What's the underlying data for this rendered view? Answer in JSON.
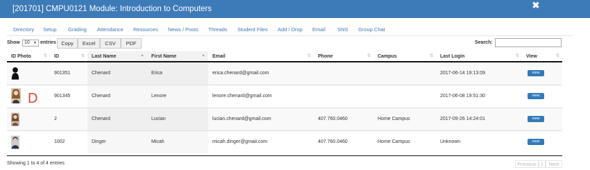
{
  "window": {
    "title": "[201701]  CMPU0121  Module: Introduction to Computers",
    "close_symbol": "✖"
  },
  "nav": [
    "Directory",
    "Setup",
    "Grading",
    "Attendance",
    "Resources",
    "News / Posts",
    "Threads",
    "Student Files",
    "Add / Drop",
    "Email",
    "SNS",
    "Group Chat"
  ],
  "controls": {
    "show_label": "Show",
    "length_value": "10",
    "entries_label": "entries",
    "buttons": [
      "Copy",
      "Excel",
      "CSV",
      "PDF"
    ],
    "search_label": "Search:",
    "search_value": ""
  },
  "table": {
    "headers": [
      "ID Photo",
      "ID",
      "Last Name",
      "First Name",
      "Email",
      "Phone",
      "Campus",
      "Last Login",
      "View"
    ],
    "rows": [
      {
        "id": "901351",
        "last": "Chenard",
        "first": "Erica",
        "email": "erica.chenard@gmail.com",
        "phone": "",
        "campus": "",
        "login": "2017-06-14 19:13:09",
        "view": "view",
        "photo": "silhouette"
      },
      {
        "id": "901345",
        "last": "Chenard",
        "first": "Lenore",
        "email": "lenore.chenard@gmail.com",
        "phone": "",
        "campus": "",
        "login": "2017-06-08 19:51:30",
        "view": "view",
        "photo": "portrait",
        "badge": "D"
      },
      {
        "id": "2",
        "last": "Chenard",
        "first": "Lucian",
        "email": "lucian.chenard@gmail.com",
        "phone": "407.760.0460",
        "campus": "Home Campus",
        "login": "2017-09-26 14:24:01",
        "view": "view",
        "photo": "portrait"
      },
      {
        "id": "1002",
        "last": "Dinger",
        "first": "Micah",
        "email": "micah.dinger@gmail.com",
        "phone": "407.760.0460",
        "campus": "Home Campus",
        "login": "Unknown",
        "view": "view",
        "photo": "portrait"
      }
    ]
  },
  "footer": {
    "info": "Showing 1 to 4 of 4 entries",
    "previous": "Previous",
    "page": "1",
    "next": "Next"
  },
  "colors": {
    "titlebar": "#3d7ab8",
    "link": "#3c78b5",
    "view_button": "#337ab7",
    "badge": "#e2412f"
  }
}
